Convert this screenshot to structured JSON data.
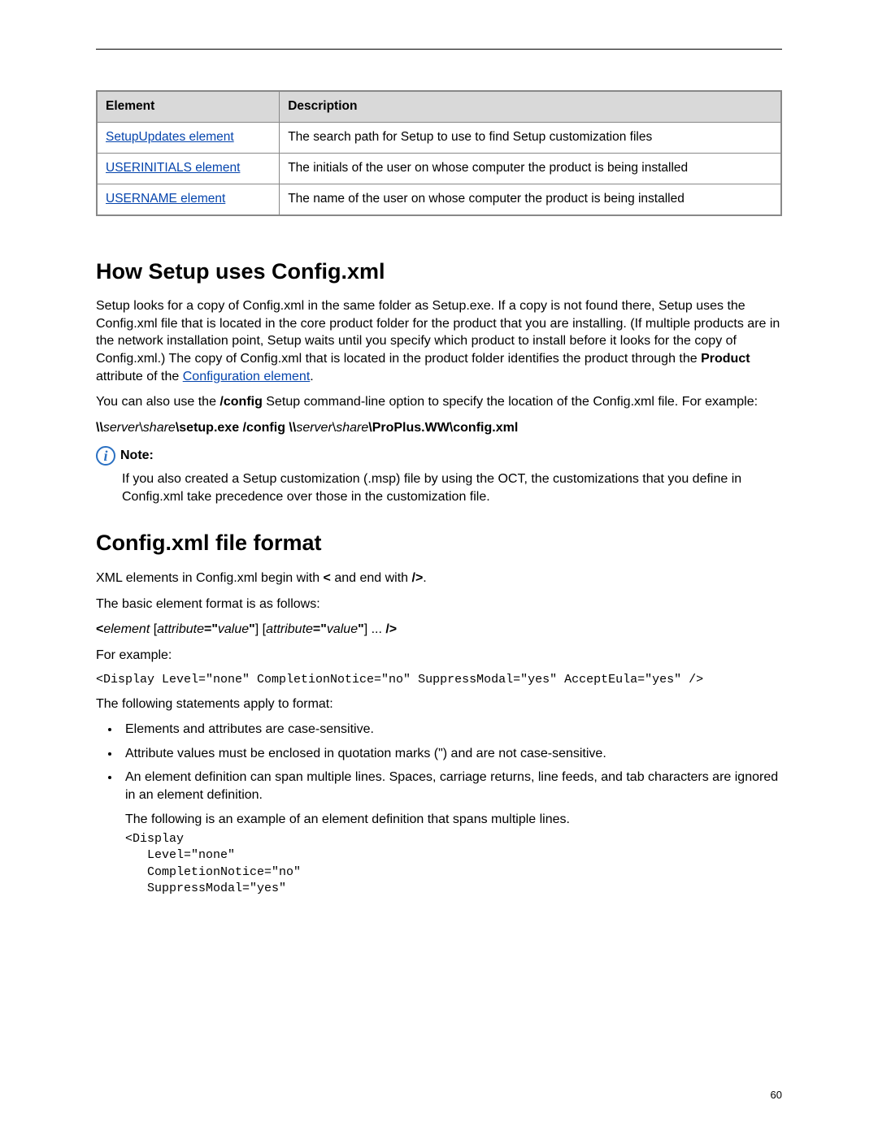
{
  "page_number": "60",
  "table": {
    "headers": [
      "Element",
      "Description"
    ],
    "rows": [
      {
        "element": "SetupUpdates element",
        "description": "The search path for Setup to use to find Setup customization files"
      },
      {
        "element": "USERINITIALS element",
        "description": "The initials of the user on whose computer the product is being installed"
      },
      {
        "element": "USERNAME element",
        "description": "The name of the user on whose computer the product is being installed"
      }
    ]
  },
  "section1": {
    "heading": "How Setup uses Config.xml",
    "p1_pre": "Setup looks for a copy of Config.xml in the same folder as Setup.exe. If a copy is not found there, Setup uses the Config.xml file that is located in the core product folder for the product that you are installing. (If multiple products are in the network installation point, Setup waits until you specify which product to install before it looks for the copy of Config.xml.) The copy of Config.xml that is located in the product folder identifies the product through the ",
    "p1_bold": "Product",
    "p1_mid": " attribute of the ",
    "p1_link": "Configuration element",
    "p1_end": ".",
    "p2_pre": "You can also use the ",
    "p2_bold": "/config",
    "p2_post": " Setup command-line option to specify the location of the Config.xml file. For example:",
    "cmd": {
      "p1": "\\\\",
      "p2_i": "server",
      "p3": "\\",
      "p4_i": "share",
      "p5_b": "\\setup.exe /config \\\\",
      "p6_i": "server",
      "p7": "\\",
      "p8_i": "share",
      "p9_b": "\\ProPlus.WW\\config.xml"
    },
    "note_label": "Note:",
    "note_icon": "i",
    "note_body": "If you also created a Setup customization (.msp) file by using the OCT, the customizations that you define in Config.xml take precedence over those in the customization file."
  },
  "section2": {
    "heading": "Config.xml file format",
    "p1_a": "XML elements in Config.xml begin with ",
    "p1_b1": "<",
    "p1_b": " and end with ",
    "p1_b2": "/>",
    "p1_c": ".",
    "p2": "The basic element format is as follows:",
    "fmt": {
      "a_b": "<",
      "b_i": "element",
      "c": " [",
      "d_i": "attribute",
      "e_b": "=\"",
      "f_i": "value",
      "g_b": "\"",
      "h": "] [",
      "i_i": "attribute",
      "j_b": "=\"",
      "k_i": "value",
      "l_b": "\"",
      "m": "] ... ",
      "n_b": "/>"
    },
    "p3": "For example:",
    "code1": "<Display Level=\"none\" CompletionNotice=\"no\" SuppressModal=\"yes\" AcceptEula=\"yes\" />",
    "p4": "The following statements apply to format:",
    "bullets": [
      "Elements and attributes are case-sensitive.",
      "Attribute values must be enclosed in quotation marks (\") and are not case-sensitive."
    ],
    "bullet3_a": "An element definition can span multiple lines. Spaces, carriage returns, line feeds, and tab characters are ignored in an element definition.",
    "bullet3_b": "The following is an example of an element definition that spans multiple lines.",
    "code2": "<Display\n   Level=\"none\"\n   CompletionNotice=\"no\"\n   SuppressModal=\"yes\""
  }
}
